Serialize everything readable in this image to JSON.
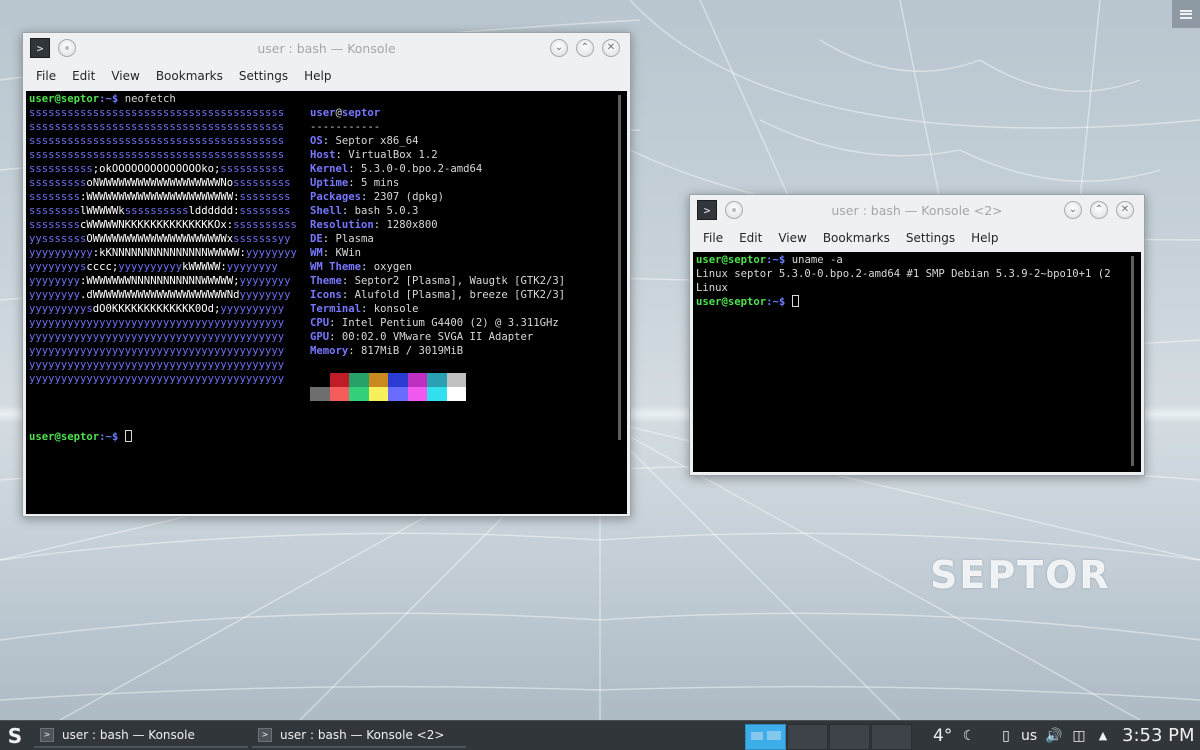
{
  "desktop": {
    "logo_text": "SEPTOR"
  },
  "window1": {
    "title": "user : bash — Konsole",
    "menu": [
      "File",
      "Edit",
      "View",
      "Bookmarks",
      "Settings",
      "Help"
    ],
    "prompt_user": "user@septor",
    "prompt_path": ":~$",
    "command": " neofetch",
    "art_lines": [
      "ssssssssssssssssssssssssssssssssssssssss",
      "ssssssssssssssssssssssssssssssssssssssss",
      "ssssssssssssssssssssssssssssssssssssssss",
      "ssssssssssssssssssssssssssssssssssssssss",
      "ssssssssss;okOOOOOOOOOOOOOOko;ssssssssss",
      "sssssssssoNWWWWWWWWWWWWWWWWWWWNosssssssss",
      "ssssssss:WWWWWWWWWWWWWWWWWWWWWWW:ssssssss",
      "sssssssslWWWWWkssssssssssldddddd:ssssssss",
      "sssssssscWWWWWNKKKKKKKKKKKKKKOx:ssssssssss",
      "yysssssssOWWWWWWWWWWWWWWWWWWWWWxsssssssyy",
      "yyyyyyyyyy:kKNNNNNNNNNNNNNNNWWWWW:yyyyyyyy",
      "yyyyyyyyscccc;yyyyyyyyyykWWWWW:yyyyyyyy",
      "yyyyyyyy:WWWWWWWNNNNNNNNNNNWWWWW;yyyyyyyy",
      "yyyyyyyy.dWWWWWWWWWWWWWWWWWWWWWNdyyyyyyyy",
      "yyyyyyyyysdO0KKKKKKKKKKKKK0Od;yyyyyyyyyy",
      "yyyyyyyyyyyyyyyyyyyyyyyyyyyyyyyyyyyyyyyy",
      "yyyyyyyyyyyyyyyyyyyyyyyyyyyyyyyyyyyyyyyy",
      "yyyyyyyyyyyyyyyyyyyyyyyyyyyyyyyyyyyyyyyy",
      "yyyyyyyyyyyyyyyyyyyyyyyyyyyyyyyyyyyyyyyy",
      "yyyyyyyyyyyyyyyyyyyyyyyyyyyyyyyyyyyyyyyy"
    ],
    "info_user": "user",
    "info_at": "@",
    "info_host": "septor",
    "info_sep": "-----------",
    "info": [
      {
        "label": "OS",
        "value": "Septor x86_64"
      },
      {
        "label": "Host",
        "value": "VirtualBox 1.2"
      },
      {
        "label": "Kernel",
        "value": "5.3.0-0.bpo.2-amd64"
      },
      {
        "label": "Uptime",
        "value": "5 mins"
      },
      {
        "label": "Packages",
        "value": "2307 (dpkg)"
      },
      {
        "label": "Shell",
        "value": "bash 5.0.3"
      },
      {
        "label": "Resolution",
        "value": "1280x800"
      },
      {
        "label": "DE",
        "value": "Plasma"
      },
      {
        "label": "WM",
        "value": "KWin"
      },
      {
        "label": "WM Theme",
        "value": "oxygen"
      },
      {
        "label": "Theme",
        "value": "Septor2 [Plasma], Waugtk [GTK2/3]"
      },
      {
        "label": "Icons",
        "value": "Alufold [Plasma], breeze [GTK2/3]"
      },
      {
        "label": "Terminal",
        "value": "konsole"
      },
      {
        "label": "CPU",
        "value": "Intel Pentium G4400 (2) @ 3.311GHz"
      },
      {
        "label": "GPU",
        "value": "00:02.0 VMware SVGA II Adapter"
      },
      {
        "label": "Memory",
        "value": "817MiB / 3019MiB"
      }
    ],
    "palette_top": [
      "#000000",
      "#c01c28",
      "#26a269",
      "#c88a1e",
      "#2a3bd4",
      "#c030c0",
      "#2aa1b3",
      "#c0c0c0"
    ],
    "palette_bottom": [
      "#6e6e6e",
      "#f55c5c",
      "#33d17a",
      "#f6f05a",
      "#6a6cff",
      "#f05af0",
      "#33e0f0",
      "#ffffff"
    ]
  },
  "window2": {
    "title": "user : bash — Konsole <2>",
    "menu": [
      "File",
      "Edit",
      "View",
      "Bookmarks",
      "Settings",
      "Help"
    ],
    "prompt_user": "user@septor",
    "prompt_path": ":~$",
    "command": " uname -a",
    "output_1": "Linux septor 5.3.0-0.bpo.2-amd64 #1 SMP Debian 5.3.9-2~bpo10+1 (2",
    "output_2": "Linux"
  },
  "taskbar": {
    "start_label": "S",
    "tasks": [
      "user : bash — Konsole",
      "user : bash — Konsole <2>"
    ],
    "temperature": "4°",
    "keyboard_layout": "us",
    "clock": "3:53 PM"
  },
  "icons": {
    "terminal": "terminal-icon",
    "pin": "pin-icon",
    "minimize": "minimize-icon",
    "maximize": "maximize-icon",
    "close": "close-icon",
    "hamburger": "hamburger-menu-icon",
    "night_mode": "night-mode-icon",
    "usb": "usb-icon",
    "volume": "volume-icon",
    "network": "network-icon",
    "tray_expand": "chevron-up-icon"
  }
}
